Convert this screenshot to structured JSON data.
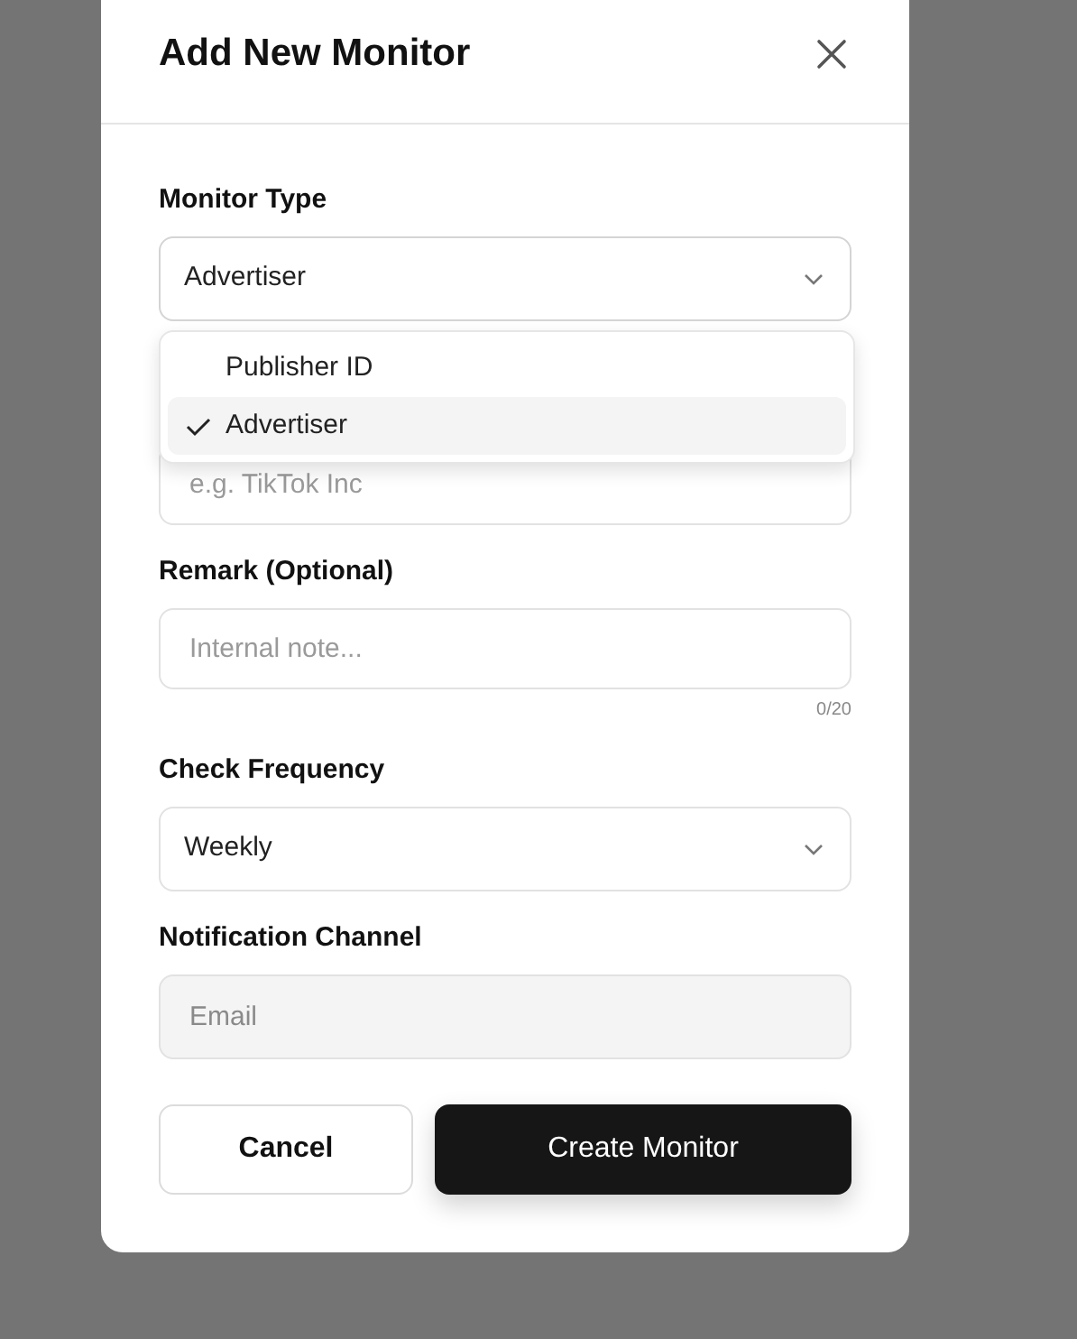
{
  "modal": {
    "title": "Add New Monitor"
  },
  "fields": [
    {
      "kind": "select",
      "label": "Monitor Type",
      "value": "Advertiser",
      "expanded": true,
      "options": [
        {
          "label": "Publisher ID",
          "selected": false
        },
        {
          "label": "Advertiser",
          "selected": true
        }
      ]
    },
    {
      "kind": "text",
      "placeholder": "e.g. TikTok Inc"
    },
    {
      "kind": "text",
      "label": "Remark (Optional)",
      "placeholder": "Internal note...",
      "counter": "0/20"
    },
    {
      "kind": "select",
      "label": "Check Frequency",
      "value": "Weekly",
      "expanded": false
    },
    {
      "kind": "text",
      "label": "Notification Channel",
      "value": "Email",
      "disabled": true
    }
  ],
  "buttons": [
    {
      "label": "Cancel",
      "primary": false
    },
    {
      "label": "Create Monitor",
      "primary": true
    }
  ]
}
